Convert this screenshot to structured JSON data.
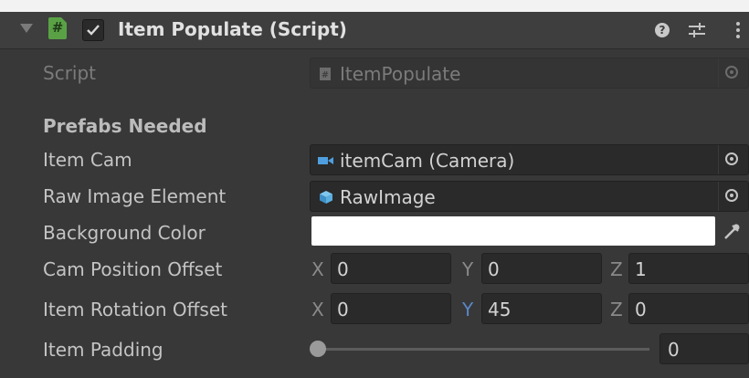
{
  "component": {
    "title": "Item Populate (Script)",
    "script_icon_glyph": "#",
    "enabled": true,
    "icons": [
      "foldout-arrow-icon",
      "script-icon",
      "help-icon",
      "presets-icon",
      "context-menu-icon"
    ]
  },
  "fields": {
    "script": {
      "label": "Script",
      "value": "ItemPopulate"
    },
    "section_header": "Prefabs Needed",
    "item_cam": {
      "label": "Item Cam",
      "value": "itemCam (Camera)",
      "icon": "camera-icon"
    },
    "raw_image": {
      "label": "Raw Image Element",
      "value": "RawImage",
      "icon": "prefab-cube-icon"
    },
    "background_color": {
      "label": "Background Color",
      "color": "#ffffff"
    },
    "cam_position_offset": {
      "label": "Cam Position Offset",
      "x": "0",
      "y": "0",
      "z": "1"
    },
    "item_rotation_offset": {
      "label": "Item Rotation Offset",
      "x": "0",
      "y": "45",
      "z": "0"
    },
    "item_padding": {
      "label": "Item Padding",
      "value": "0",
      "slider_fraction": 0
    }
  },
  "axis_labels": {
    "x": "X",
    "y": "Y",
    "z": "Z"
  },
  "colors": {
    "background": "#383838",
    "field": "#2a2a2a",
    "script_icon": "#5aa146",
    "axis_highlight": "#5a87c9",
    "camera_icon": "#4f9fe0"
  }
}
